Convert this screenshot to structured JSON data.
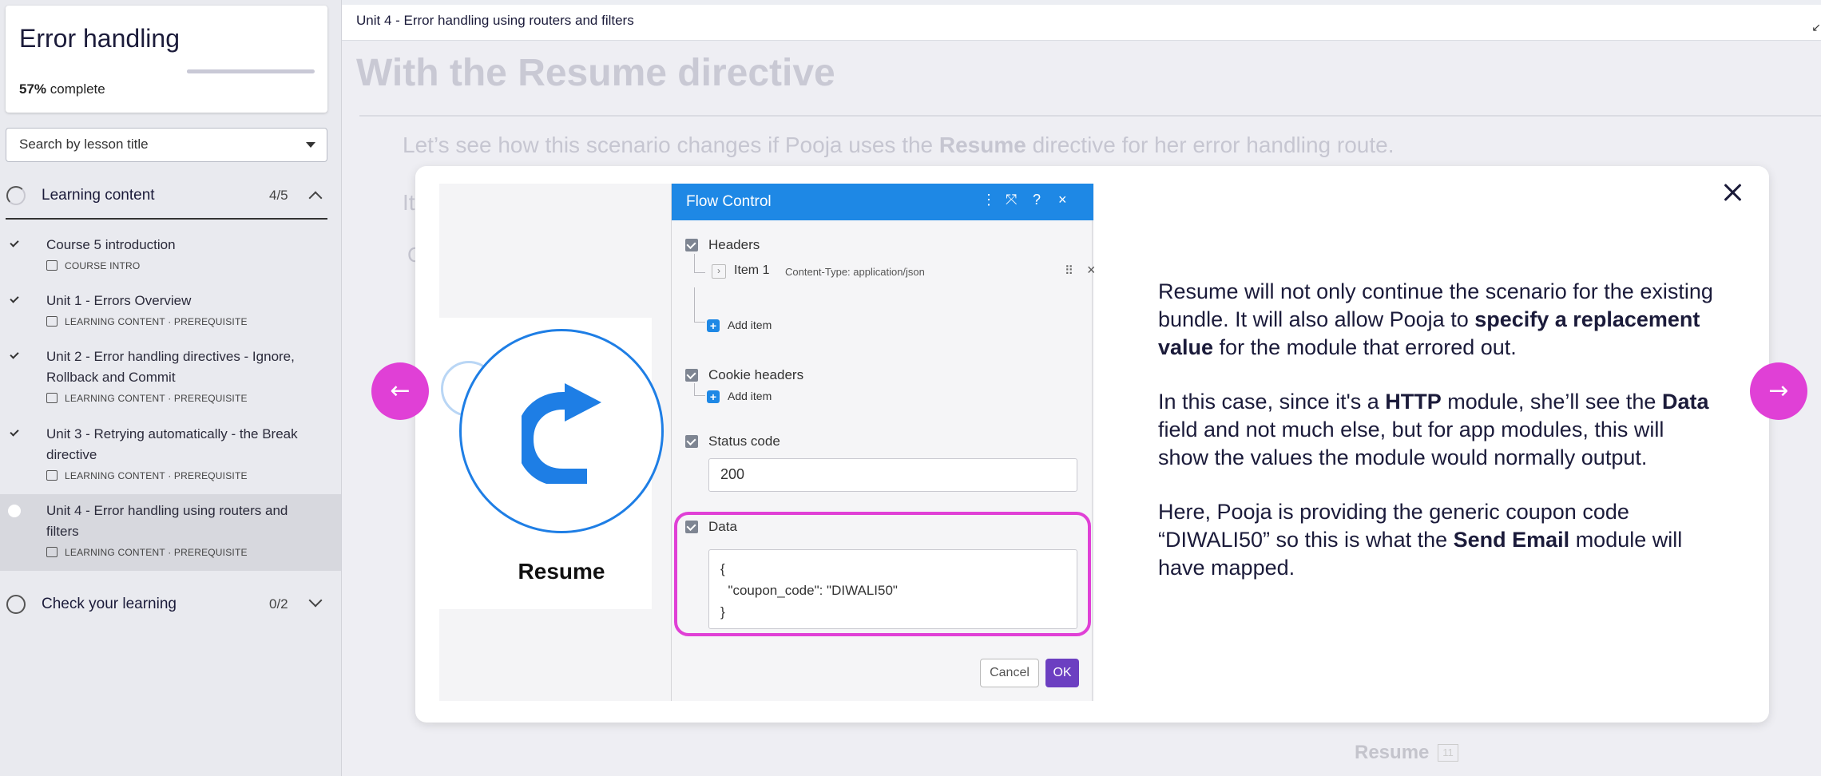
{
  "sidebar": {
    "course_title": "Error handling",
    "progress_value": 0.57,
    "progress_percent": "57%",
    "progress_suffix": " complete",
    "search_placeholder": "Search by lesson title",
    "sections": [
      {
        "label": "Learning content",
        "count": "4/5",
        "expanded": true
      },
      {
        "label": "Check your learning",
        "count": "0/2",
        "expanded": false
      }
    ],
    "lessons": [
      {
        "title": "Course 5 introduction",
        "meta": "COURSE INTRO",
        "completed": true,
        "active": false
      },
      {
        "title": "Unit 1 - Errors Overview",
        "meta": "LEARNING CONTENT · PREREQUISITE",
        "completed": true,
        "active": false
      },
      {
        "title": "Unit 2 - Error handling directives - Ignore, Rollback and Commit",
        "meta": "LEARNING CONTENT · PREREQUISITE",
        "completed": true,
        "active": false
      },
      {
        "title": "Unit 3 - Retrying automatically - the Break directive",
        "meta": "LEARNING CONTENT · PREREQUISITE",
        "completed": true,
        "active": false
      },
      {
        "title": "Unit 4 - Error handling using routers and filters",
        "meta": "LEARNING CONTENT · PREREQUISITE",
        "completed": false,
        "active": true
      }
    ]
  },
  "topbar": {
    "breadcrumb": "Unit 4 - Error handling using routers and filters"
  },
  "background": {
    "heading": "With the Resume directive",
    "para_pre": "Let’s see how this scenario changes if Pooja uses the ",
    "para_bold": "Resume",
    "para_post": " directive for her error handling route.",
    "frag1": "It",
    "frag2": "C",
    "resume_label": "Resume",
    "resume_badge": "11"
  },
  "modal": {
    "image": {
      "resume_label": "Resume",
      "flow_title": "Flow Control",
      "headers_label": "Headers",
      "item_name": "Item 1",
      "item_desc": "Content-Type: application/json",
      "add_item_label": "Add item",
      "cookie_headers_label": "Cookie headers",
      "status_code_label": "Status code",
      "status_code_value": "200",
      "data_label": "Data",
      "data_value": "{\n  \"coupon_code\": \"DIWALI50\"\n}",
      "cancel_label": "Cancel",
      "ok_label": "OK"
    },
    "text": {
      "p1_a": "Resume will not only continue the scenario for the existing bundle. It will also allow Pooja to ",
      "p1_b": "specify a replacement value",
      "p1_c": " for the module that errored out.",
      "p2_a": "In this case, since it's a ",
      "p2_b": "HTTP",
      "p2_c": " module, she’ll see the ",
      "p2_d": "Data",
      "p2_e": " field and not much else, but for app modules, this will show the values the module would normally output.",
      "p3_a": "Here, Pooja is providing the generic coupon code “DIWALI50” so this is what the ",
      "p3_b": "Send Email",
      "p3_c": " module will have mapped."
    }
  },
  "icons": {
    "prev": "arrow-left-icon",
    "next": "arrow-right-icon",
    "close": "close-icon",
    "collapse": "collapse-icon"
  },
  "colors": {
    "accent": "#e040d6",
    "flow_header": "#1e88e5",
    "ok_button": "#6c3fc1",
    "resume_blue": "#1e7ee5"
  }
}
